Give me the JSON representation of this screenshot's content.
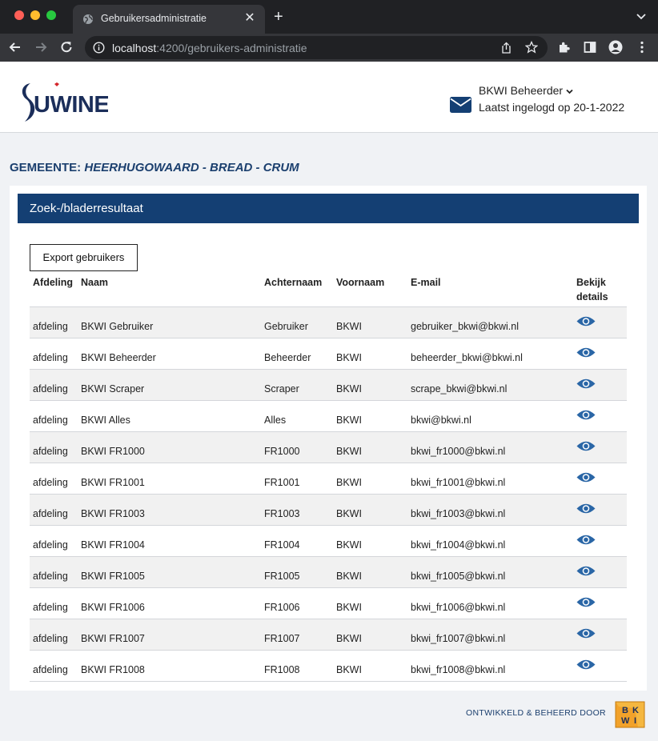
{
  "browser": {
    "tab_title": "Gebruikersadministratie",
    "tab_close": "✕",
    "new_tab": "+",
    "url_host": "localhost",
    "url_path": ":4200/gebruikers-administratie"
  },
  "header": {
    "logo_text": "UWINET",
    "user_name": "BKWI Beheerder",
    "last_login": "Laatst ingelogd op 20-1-2022"
  },
  "gemeente": {
    "label": "GEMEENTE:",
    "value": "HEERHUGOWAARD - BREAD - CRUM"
  },
  "card": {
    "title": "Zoek-/bladerresultaat",
    "export_label": "Export gebruikers"
  },
  "table": {
    "columns": [
      "Afdeling",
      "Naam",
      "Achternaam",
      "Voornaam",
      "E-mail",
      "Bekijk details"
    ],
    "rows": [
      [
        "afdeling",
        "BKWI Gebruiker",
        "Gebruiker",
        "BKWI",
        "gebruiker_bkwi@bkwi.nl"
      ],
      [
        "afdeling",
        "BKWI Beheerder",
        "Beheerder",
        "BKWI",
        "beheerder_bkwi@bkwi.nl"
      ],
      [
        "afdeling",
        "BKWI Scraper",
        "Scraper",
        "BKWI",
        "scrape_bkwi@bkwi.nl"
      ],
      [
        "afdeling",
        "BKWI Alles",
        "Alles",
        "BKWI",
        "bkwi@bkwi.nl"
      ],
      [
        "afdeling",
        "BKWI FR1000",
        "FR1000",
        "BKWI",
        "bkwi_fr1000@bkwi.nl"
      ],
      [
        "afdeling",
        "BKWI FR1001",
        "FR1001",
        "BKWI",
        "bkwi_fr1001@bkwi.nl"
      ],
      [
        "afdeling",
        "BKWI FR1003",
        "FR1003",
        "BKWI",
        "bkwi_fr1003@bkwi.nl"
      ],
      [
        "afdeling",
        "BKWI FR1004",
        "FR1004",
        "BKWI",
        "bkwi_fr1004@bkwi.nl"
      ],
      [
        "afdeling",
        "BKWI FR1005",
        "FR1005",
        "BKWI",
        "bkwi_fr1005@bkwi.nl"
      ],
      [
        "afdeling",
        "BKWI FR1006",
        "FR1006",
        "BKWI",
        "bkwi_fr1006@bkwi.nl"
      ],
      [
        "afdeling",
        "BKWI FR1007",
        "FR1007",
        "BKWI",
        "bkwi_fr1007@bkwi.nl"
      ],
      [
        "afdeling",
        "BKWI FR1008",
        "FR1008",
        "BKWI",
        "bkwi_fr1008@bkwi.nl"
      ]
    ]
  },
  "footer": {
    "text": "ONTWIKKELD  & BEHEERD DOOR",
    "logo_letters": [
      "B",
      "K",
      "W",
      "I"
    ]
  },
  "colors": {
    "brand_navy": "#143f73",
    "eye_icon": "#2a66a6",
    "row_alt": "#f1f1f1",
    "bkwi_orange": "#f2a22a"
  }
}
